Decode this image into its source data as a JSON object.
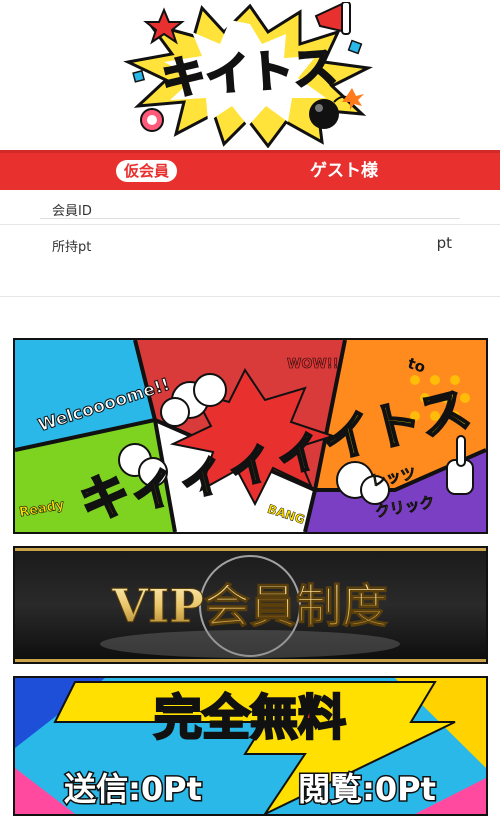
{
  "logo": {
    "text": "キイトス"
  },
  "member": {
    "status_badge": "仮会員",
    "name": "ゲスト様"
  },
  "info": {
    "member_id_label": "会員ID",
    "member_id_value": "",
    "points_label": "所持pt",
    "points_value": "pt"
  },
  "banners": {
    "welcome": {
      "main_text": "キィィィィイトス",
      "welcome_text": "Welcoooome!!",
      "wow_text": "WOW!!",
      "to_text": "to",
      "ready_text": "Ready",
      "bang_text": "BANG",
      "lets_text": "レッツ",
      "click_text": "クリック"
    },
    "vip": {
      "text": "VIP会員制度"
    },
    "free": {
      "title": "完全無料",
      "send_text": "送信:0Pt",
      "view_text": "閲覧:0Pt"
    }
  },
  "colors": {
    "accent_red": "#e8312f",
    "gold": "#e9c66a",
    "comic_yellow": "#ffe000"
  }
}
